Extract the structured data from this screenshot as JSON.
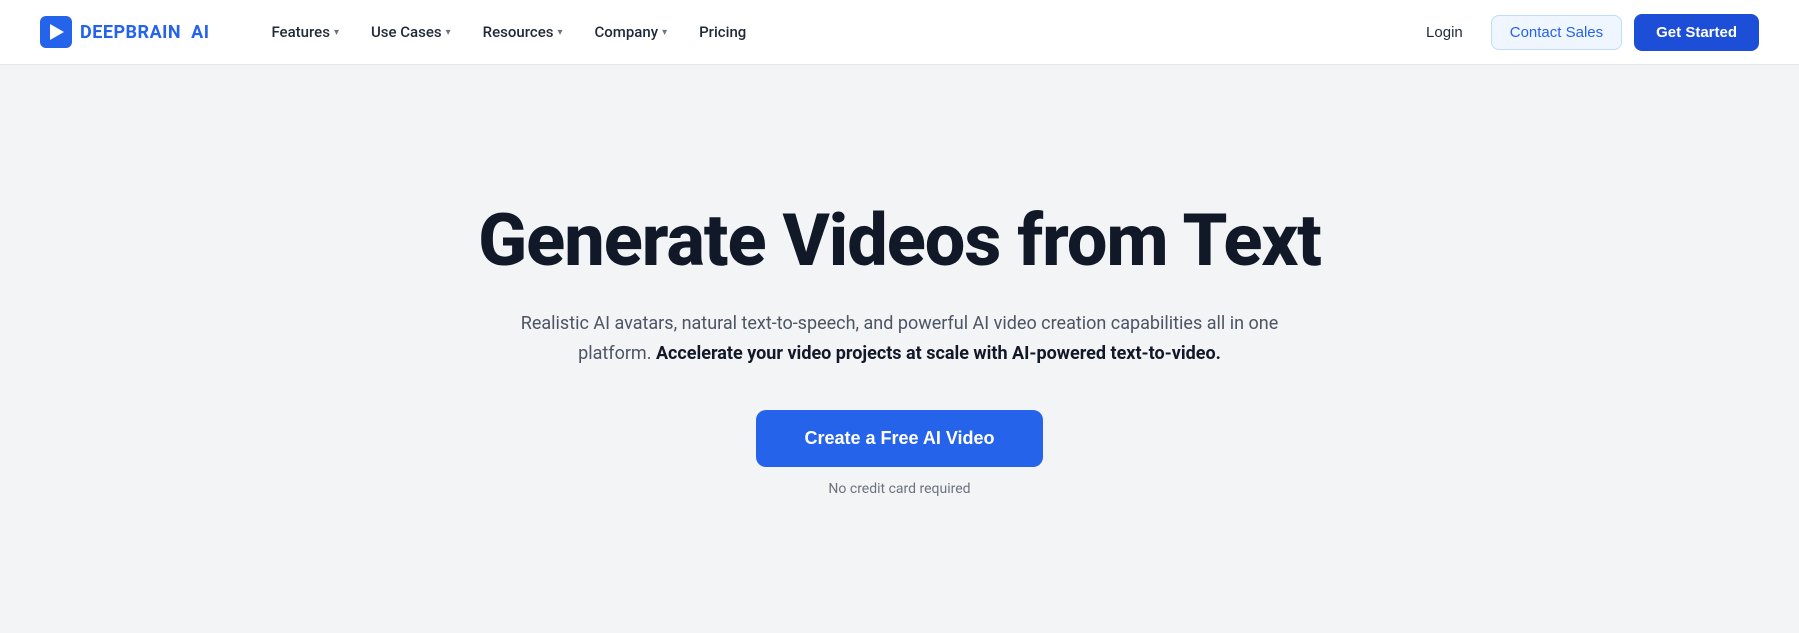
{
  "brand": {
    "logo_text": "DEEPBRAIN AI",
    "logo_text_part1": "DEEPBRAIN",
    "logo_text_part2": "AI"
  },
  "navbar": {
    "items": [
      {
        "label": "Features",
        "has_dropdown": true
      },
      {
        "label": "Use Cases",
        "has_dropdown": true
      },
      {
        "label": "Resources",
        "has_dropdown": true
      },
      {
        "label": "Company",
        "has_dropdown": true
      },
      {
        "label": "Pricing",
        "has_dropdown": false
      }
    ],
    "login_label": "Login",
    "contact_sales_label": "Contact Sales",
    "get_started_label": "Get Started"
  },
  "hero": {
    "title": "Generate Videos from Text",
    "subtitle_normal": "Realistic AI avatars, natural text-to-speech, and powerful AI video creation capabilities all in one platform.",
    "subtitle_bold": " Accelerate your video projects at scale with AI-powered text-to-video.",
    "cta_label": "Create a Free AI Video",
    "note": "No credit card required"
  }
}
